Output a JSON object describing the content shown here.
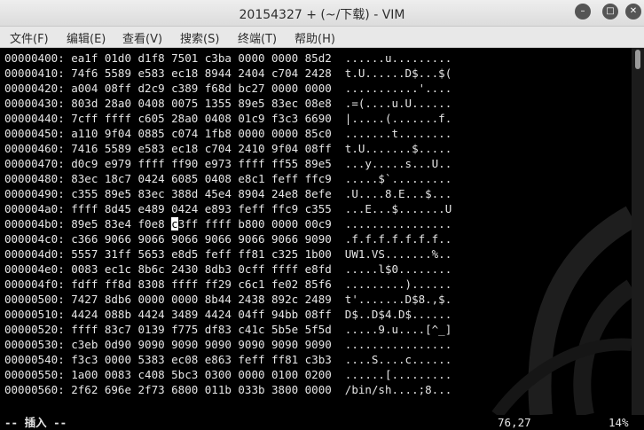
{
  "window": {
    "title": "20154327 + (~/下载) - VIM",
    "minimize_glyph": "–",
    "maximize_glyph": "□",
    "close_glyph": "✕"
  },
  "menu": [
    {
      "label": "文件(F)"
    },
    {
      "label": "编辑(E)"
    },
    {
      "label": "查看(V)"
    },
    {
      "label": "搜索(S)"
    },
    {
      "label": "终端(T)"
    },
    {
      "label": "帮助(H)"
    }
  ],
  "hex_lines": [
    "00000400: ea1f 01d0 d1f8 7501 c3ba 0000 0000 85d2  ......u.........",
    "00000410: 74f6 5589 e583 ec18 8944 2404 c704 2428  t.U......D$...$(",
    "00000420: a004 08ff d2c9 c389 f68d bc27 0000 0000  ...........'....",
    "00000430: 803d 28a0 0408 0075 1355 89e5 83ec 08e8  .=(....u.U......",
    "00000440: 7cff ffff c605 28a0 0408 01c9 f3c3 6690  |.....(.......f.",
    "00000450: a110 9f04 0885 c074 1fb8 0000 0000 85c0  .......t........",
    "00000460: 7416 5589 e583 ec18 c704 2410 9f04 08ff  t.U.......$.....",
    "00000470: d0c9 e979 ffff ff90 e973 ffff ff55 89e5  ...y.....s...U..",
    "00000480: 83ec 18c7 0424 6085 0408 e8c1 feff ffc9  .....$`.........",
    "00000490: c355 89e5 83ec 388d 45e4 8904 24e8 8efe  .U....8.E...$...",
    "000004a0: ffff 8d45 e489 0424 e893 feff ffc9 c355  ...E...$.......U",
    "000004b0: 89e5 83e4 f0e8 c3ff ffff b800 0000 00c9  ................",
    "000004c0: c366 9066 9066 9066 9066 9066 9066 9090  .f.f.f.f.f.f.f..",
    "000004d0: 5557 31ff 5653 e8d5 feff ff81 c325 1b00  UW1.VS.......%..",
    "000004e0: 0083 ec1c 8b6c 2430 8db3 0cff ffff e8fd  .....l$0........",
    "000004f0: fdff ff8d 8308 ffff ff29 c6c1 fe02 85f6  .........)......",
    "00000500: 7427 8db6 0000 0000 8b44 2438 892c 2489  t'.......D$8.,$.",
    "00000510: 4424 088b 4424 3489 4424 04ff 94bb 08ff  D$..D$4.D$......",
    "00000520: ffff 83c7 0139 f775 df83 c41c 5b5e 5f5d  .....9.u....[^_]",
    "00000530: c3eb 0d90 9090 9090 9090 9090 9090 9090  ................",
    "00000540: f3c3 0000 5383 ec08 e863 feff ff81 c3b3  ....S....c......",
    "00000550: 1a00 0083 c408 5bc3 0300 0000 0100 0200  ......[.........",
    "00000560: 2f62 696e 2f73 6800 011b 033b 3800 0000  /bin/sh....;8..."
  ],
  "cursor": {
    "before": "000004b0: 89e5 83e4 f0e8 ",
    "char": "c",
    "after": "3ff ffff b800 0000 00c9  ................"
  },
  "status": {
    "mode": "-- 插入 --",
    "position": "76,27",
    "percent": "14%"
  },
  "colors": {
    "background": "#000000",
    "text": "#e6e6e6",
    "titlebar": "#e6e6e6",
    "cursor": "#ffffff"
  }
}
